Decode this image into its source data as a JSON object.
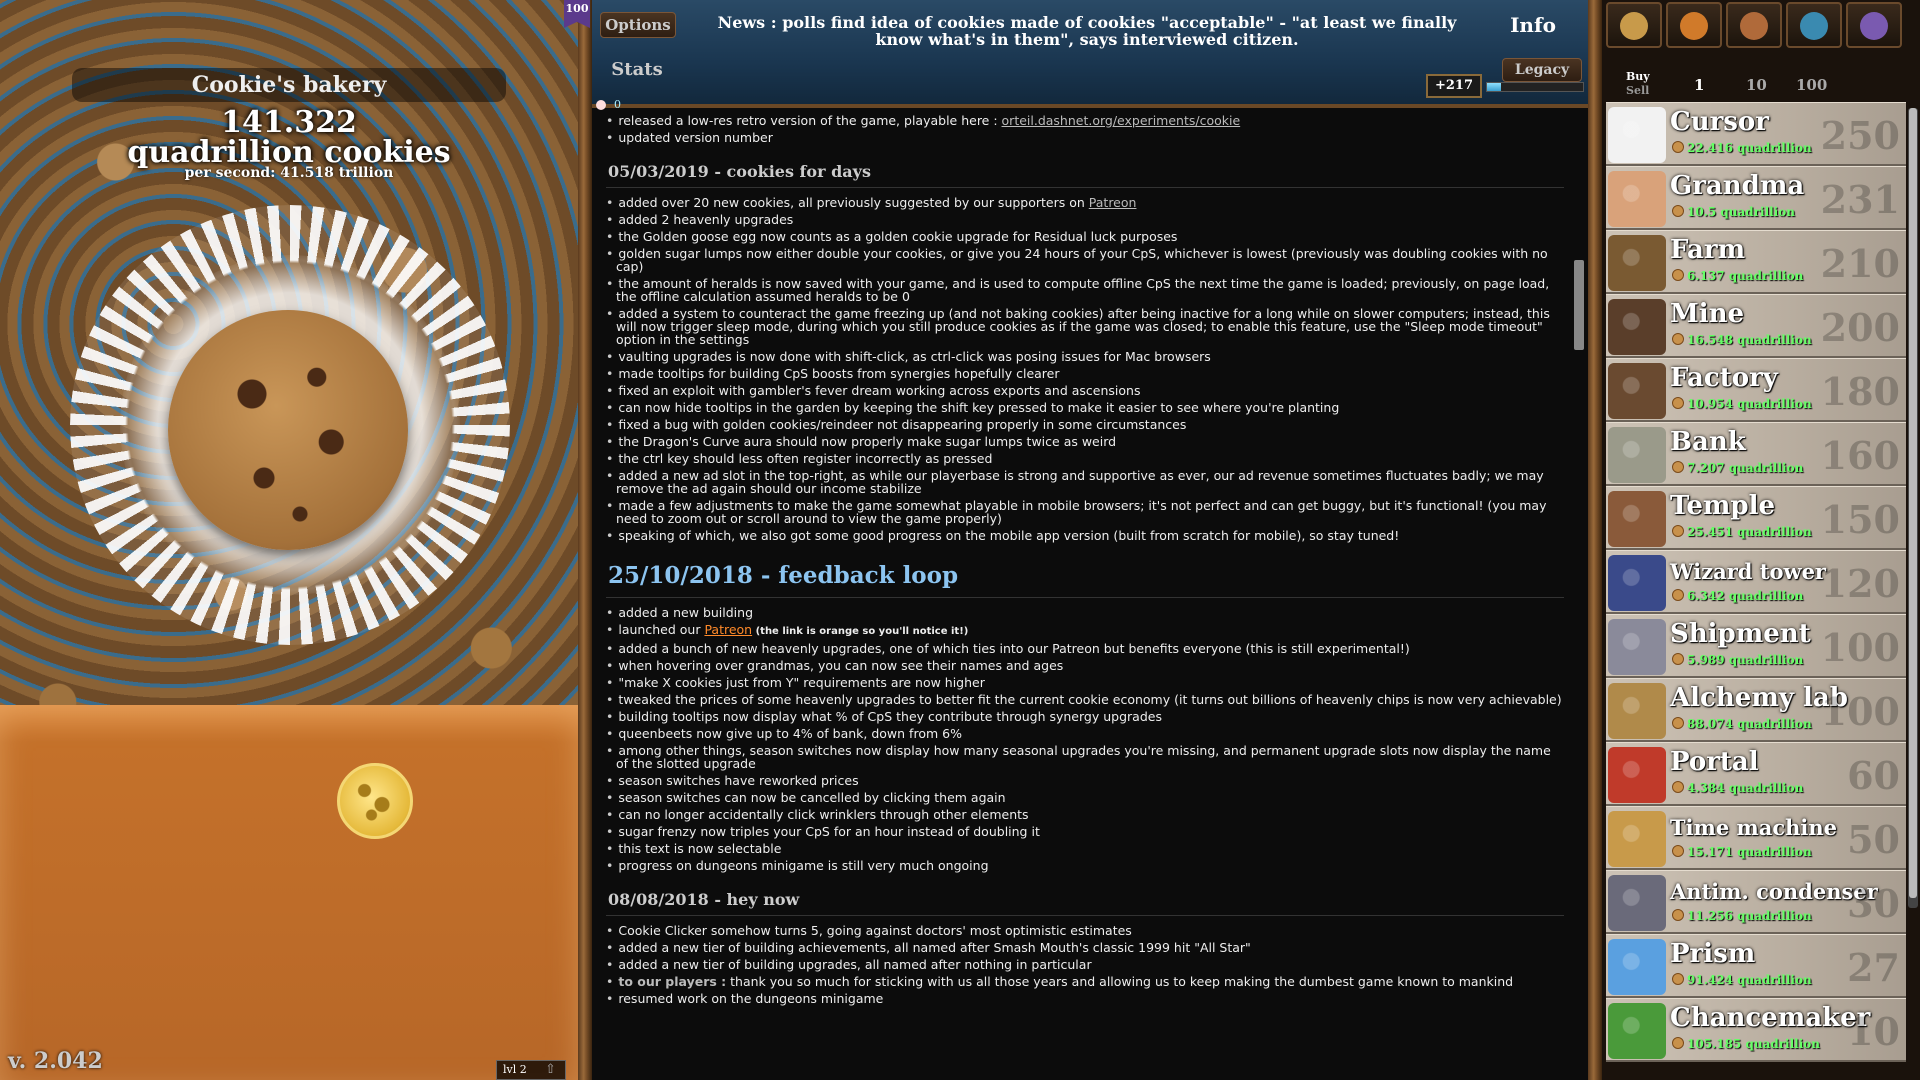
{
  "left": {
    "bakery_name": "Cookie's bakery",
    "cookies_amount": "141.322",
    "cookies_unit": "quadrillion cookies",
    "per_second": "per second: 41.518 trillion",
    "version": "v. 2.042",
    "level": "lvl 2"
  },
  "top": {
    "badge": "100",
    "options": "Options",
    "stats": "Stats",
    "info": "Info",
    "legacy": "Legacy",
    "news": "News : polls find idea of cookies made of cookies \"acceptable\" - \"at least we finally know what's in them\", says interviewed citizen.",
    "prestige_gain": "+217",
    "prestige_progress": 0.15,
    "heavenly_chips": "0"
  },
  "log": {
    "intro": [
      "released a low-res retro version of the game, playable here : ",
      "updated version number"
    ],
    "intro_link": "orteil.dashnet.org/experiments/cookie",
    "sec1_title": "05/03/2019 - cookies for days",
    "sec1_patreon": "Patreon",
    "sec1_first": "added over 20 new cookies, all previously suggested by our supporters on ",
    "sec1": [
      "added 2 heavenly upgrades",
      "the Golden goose egg now counts as a golden cookie upgrade for Residual luck purposes",
      "golden sugar lumps now either double your cookies, or give you 24 hours of your CpS, whichever is lowest (previously was doubling cookies with no cap)",
      "the amount of heralds is now saved with your game, and is used to compute offline CpS the next time the game is loaded; previously, on page load, the offline calculation assumed heralds to be 0",
      "added a system to counteract the game freezing up (and not baking cookies) after being inactive for a long while on slower computers; instead, this will now trigger sleep mode, during which you still produce cookies as if the game was closed; to enable this feature, use the \"Sleep mode timeout\" option in the settings",
      "vaulting upgrades is now done with shift-click, as ctrl-click was posing issues for Mac browsers",
      "made tooltips for building CpS boosts from synergies hopefully clearer",
      "fixed an exploit with gambler's fever dream working across exports and ascensions",
      "can now hide tooltips in the garden by keeping the shift key pressed to make it easier to see where you're planting",
      "fixed a bug with golden cookies/reindeer not disappearing properly in some circumstances",
      "the Dragon's Curve aura should now properly make sugar lumps twice as weird",
      "the ctrl key should less often register incorrectly as pressed",
      "added a new ad slot in the top-right, as while our playerbase is strong and supportive as ever, our ad revenue sometimes fluctuates badly; we may remove the ad again should our income stabilize",
      "made a few adjustments to make the game somewhat playable in mobile browsers; it's not perfect and can get buggy, but it's functional! (you may need to zoom out or scroll around to view the game properly)",
      "speaking of which, we also got some good progress on the mobile app version (built from scratch for mobile), so stay tuned!"
    ],
    "sec2_title": "25/10/2018 - feedback loop",
    "sec2_first": "added a new building",
    "sec2_launch_pre": "launched our ",
    "sec2_launch_link": "Patreon",
    "sec2_launch_note": " (the link is orange so you'll notice it!)",
    "sec2": [
      "added a bunch of new heavenly upgrades, one of which ties into our Patreon but benefits everyone (this is still experimental!)",
      "when hovering over grandmas, you can now see their names and ages",
      "\"make X cookies just from Y\" requirements are now higher",
      "tweaked the prices of some heavenly upgrades to better fit the current cookie economy (it turns out billions of heavenly chips is now very achievable)",
      "building tooltips now display what % of CpS they contribute through synergy upgrades",
      "queenbeets now give up to 4% of bank, down from 6%",
      "among other things, season switches now display how many seasonal upgrades you're missing, and permanent upgrade slots now display the name of the slotted upgrade",
      "season switches have reworked prices",
      "season switches can now be cancelled by clicking them again",
      "can no longer accidentally click wrinklers through other elements",
      "sugar frenzy now triples your CpS for an hour instead of doubling it",
      "this text is now selectable",
      "progress on dungeons minigame is still very much ongoing"
    ],
    "sec3_title": "08/08/2018 - hey now",
    "sec3": [
      "Cookie Clicker somehow turns 5, going against doctors' most optimistic estimates",
      "added a new tier of building achievements, all named after Smash Mouth's classic 1999 hit \"All Star\"",
      "added a new tier of building upgrades, all named after nothing in particular"
    ],
    "sec3_players_bold": "to our players :",
    "sec3_players_text": " thank you so much for sticking with us all those years and allowing us to keep making the dumbest game known to mankind",
    "sec3_last": "resumed work on the dungeons minigame"
  },
  "store": {
    "buy": "Buy",
    "sell": "Sell",
    "amounts": [
      "1",
      "10",
      "100"
    ],
    "buildings": [
      {
        "name": "Cursor",
        "price": "22.416 quadrillion",
        "owned": "250",
        "color": "#f2f2f2"
      },
      {
        "name": "Grandma",
        "price": "10.5 quadrillion",
        "owned": "231",
        "color": "#d9a27a"
      },
      {
        "name": "Farm",
        "price": "6.137 quadrillion",
        "owned": "210",
        "color": "#7a5a32"
      },
      {
        "name": "Mine",
        "price": "16.548 quadrillion",
        "owned": "200",
        "color": "#5a3e2a"
      },
      {
        "name": "Factory",
        "price": "10.954 quadrillion",
        "owned": "180",
        "color": "#6a4a30"
      },
      {
        "name": "Bank",
        "price": "7.207 quadrillion",
        "owned": "160",
        "color": "#9a9a8a"
      },
      {
        "name": "Temple",
        "price": "25.451 quadrillion",
        "owned": "150",
        "color": "#8a5a3a"
      },
      {
        "name": "Wizard tower",
        "price": "6.342 quadrillion",
        "owned": "120",
        "color": "#3a4a8a"
      },
      {
        "name": "Shipment",
        "price": "5.989 quadrillion",
        "owned": "100",
        "color": "#8a8a9a"
      },
      {
        "name": "Alchemy lab",
        "price": "88.074 quadrillion",
        "owned": "100",
        "color": "#b08a4a"
      },
      {
        "name": "Portal",
        "price": "4.384 quadrillion",
        "owned": "60",
        "color": "#c03a2a"
      },
      {
        "name": "Time machine",
        "price": "15.171 quadrillion",
        "owned": "50",
        "color": "#c89a4a"
      },
      {
        "name": "Antim. condenser",
        "price": "11.256 quadrillion",
        "owned": "30",
        "color": "#6a6a7a"
      },
      {
        "name": "Prism",
        "price": "91.424 quadrillion",
        "owned": "27",
        "color": "#5aa0e0"
      },
      {
        "name": "Chancemaker",
        "price": "105.185 quadrillion",
        "owned": "10",
        "color": "#4a9a3a"
      }
    ]
  }
}
